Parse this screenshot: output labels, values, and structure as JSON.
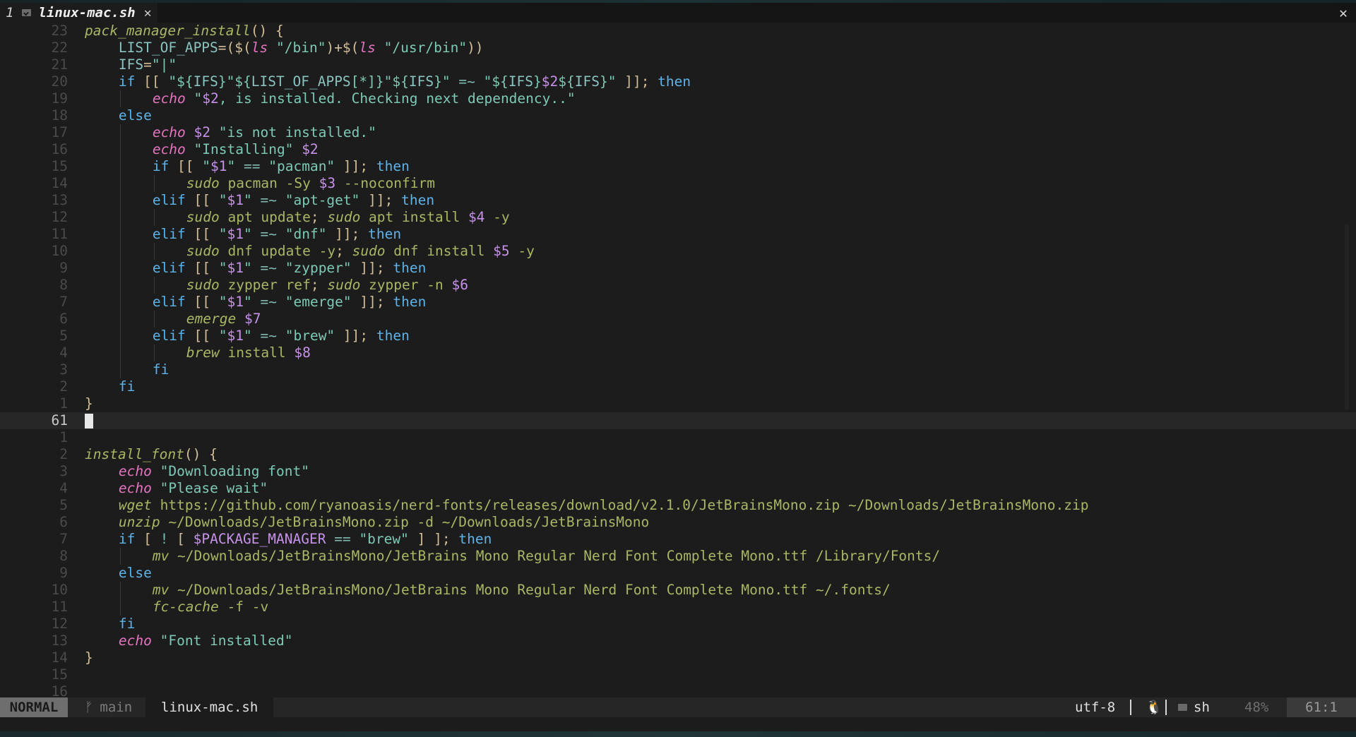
{
  "tabline": {
    "tab_number": "1",
    "file_icon": "file-icon",
    "tab_label": "linux-mac.sh",
    "tab_close": "✕",
    "close_all": "✕"
  },
  "editor": {
    "lines": [
      {
        "n": "23",
        "indent": 0,
        "segs": [
          [
            "fn",
            "pack_manager_install"
          ],
          [
            "pn",
            "() {"
          ]
        ]
      },
      {
        "n": "22",
        "indent": 1,
        "segs": [
          [
            "id",
            "LIST_OF_APPS"
          ],
          [
            "sv",
            "=($("
          ],
          [
            "cmd",
            "ls"
          ],
          [
            "sv",
            " "
          ],
          [
            "str",
            "\"/bin\""
          ],
          [
            "sv",
            ")+$("
          ],
          [
            "cmd",
            "ls"
          ],
          [
            "sv",
            " "
          ],
          [
            "str",
            "\"/usr/bin\""
          ],
          [
            "sv",
            "))"
          ]
        ]
      },
      {
        "n": "21",
        "indent": 1,
        "segs": [
          [
            "id",
            "IFS"
          ],
          [
            "sv",
            "="
          ],
          [
            "str",
            "\"|\""
          ]
        ]
      },
      {
        "n": "20",
        "indent": 1,
        "segs": [
          [
            "kw",
            "if"
          ],
          [
            "sv",
            " [[ "
          ],
          [
            "str",
            "\"${"
          ],
          [
            "id",
            "IFS"
          ],
          [
            "str",
            "}\"${"
          ],
          [
            "id",
            "LIST_OF_APPS"
          ],
          [
            "str",
            "[*]}\"${"
          ],
          [
            "id",
            "IFS"
          ],
          [
            "str",
            "}\""
          ],
          [
            "sv",
            " "
          ],
          [
            "op",
            "=~"
          ],
          [
            "sv",
            " "
          ],
          [
            "str",
            "\"${"
          ],
          [
            "id",
            "IFS"
          ],
          [
            "str",
            "}"
          ],
          [
            "var",
            "$2"
          ],
          [
            "str",
            "${"
          ],
          [
            "id",
            "IFS"
          ],
          [
            "str",
            "}\""
          ],
          [
            "sv",
            " ]]; "
          ],
          [
            "kw",
            "then"
          ]
        ]
      },
      {
        "n": "19",
        "indent": 2,
        "segs": [
          [
            "cmd",
            "echo"
          ],
          [
            "sv",
            " "
          ],
          [
            "str",
            "\""
          ],
          [
            "var",
            "$2"
          ],
          [
            "str",
            ", is installed. Checking next dependency..\""
          ]
        ]
      },
      {
        "n": "18",
        "indent": 1,
        "segs": [
          [
            "kw",
            "else"
          ]
        ]
      },
      {
        "n": "17",
        "indent": 2,
        "segs": [
          [
            "cmd",
            "echo"
          ],
          [
            "sv",
            " "
          ],
          [
            "var",
            "$2"
          ],
          [
            "sv",
            " "
          ],
          [
            "str",
            "\"is not installed.\""
          ]
        ]
      },
      {
        "n": "16",
        "indent": 2,
        "segs": [
          [
            "cmd",
            "echo"
          ],
          [
            "sv",
            " "
          ],
          [
            "str",
            "\"Installing\""
          ],
          [
            "sv",
            " "
          ],
          [
            "var",
            "$2"
          ]
        ]
      },
      {
        "n": "15",
        "indent": 2,
        "segs": [
          [
            "kw",
            "if"
          ],
          [
            "sv",
            " [[ "
          ],
          [
            "str",
            "\""
          ],
          [
            "var",
            "$1"
          ],
          [
            "str",
            "\""
          ],
          [
            "sv",
            " "
          ],
          [
            "op",
            "=="
          ],
          [
            "sv",
            " "
          ],
          [
            "str",
            "\"pacman\""
          ],
          [
            "sv",
            " ]]; "
          ],
          [
            "kw",
            "then"
          ]
        ]
      },
      {
        "n": "14",
        "indent": 3,
        "segs": [
          [
            "ucmd",
            "sudo"
          ],
          [
            "arg",
            " pacman -Sy "
          ],
          [
            "var",
            "$3"
          ],
          [
            "arg",
            " --noconfirm"
          ]
        ]
      },
      {
        "n": "13",
        "indent": 2,
        "segs": [
          [
            "kw",
            "elif"
          ],
          [
            "sv",
            " [[ "
          ],
          [
            "str",
            "\""
          ],
          [
            "var",
            "$1"
          ],
          [
            "str",
            "\""
          ],
          [
            "sv",
            " "
          ],
          [
            "op",
            "=~"
          ],
          [
            "sv",
            " "
          ],
          [
            "str",
            "\"apt-get\""
          ],
          [
            "sv",
            " ]]; "
          ],
          [
            "kw",
            "then"
          ]
        ]
      },
      {
        "n": "12",
        "indent": 3,
        "segs": [
          [
            "ucmd",
            "sudo"
          ],
          [
            "arg",
            " apt update"
          ],
          [
            "sv",
            "; "
          ],
          [
            "ucmd",
            "sudo"
          ],
          [
            "arg",
            " apt install "
          ],
          [
            "var",
            "$4"
          ],
          [
            "arg",
            " -y"
          ]
        ]
      },
      {
        "n": "11",
        "indent": 2,
        "segs": [
          [
            "kw",
            "elif"
          ],
          [
            "sv",
            " [[ "
          ],
          [
            "str",
            "\""
          ],
          [
            "var",
            "$1"
          ],
          [
            "str",
            "\""
          ],
          [
            "sv",
            " "
          ],
          [
            "op",
            "=~"
          ],
          [
            "sv",
            " "
          ],
          [
            "str",
            "\"dnf\""
          ],
          [
            "sv",
            " ]]; "
          ],
          [
            "kw",
            "then"
          ]
        ]
      },
      {
        "n": "10",
        "indent": 3,
        "segs": [
          [
            "ucmd",
            "sudo"
          ],
          [
            "arg",
            " dnf update -y"
          ],
          [
            "sv",
            "; "
          ],
          [
            "ucmd",
            "sudo"
          ],
          [
            "arg",
            " dnf install "
          ],
          [
            "var",
            "$5"
          ],
          [
            "arg",
            " -y"
          ]
        ]
      },
      {
        "n": "9",
        "indent": 2,
        "segs": [
          [
            "kw",
            "elif"
          ],
          [
            "sv",
            " [[ "
          ],
          [
            "str",
            "\""
          ],
          [
            "var",
            "$1"
          ],
          [
            "str",
            "\""
          ],
          [
            "sv",
            " "
          ],
          [
            "op",
            "=~"
          ],
          [
            "sv",
            " "
          ],
          [
            "str",
            "\"zypper\""
          ],
          [
            "sv",
            " ]]; "
          ],
          [
            "kw",
            "then"
          ]
        ]
      },
      {
        "n": "8",
        "indent": 3,
        "segs": [
          [
            "ucmd",
            "sudo"
          ],
          [
            "arg",
            " zypper ref"
          ],
          [
            "sv",
            "; "
          ],
          [
            "ucmd",
            "sudo"
          ],
          [
            "arg",
            " zypper -n "
          ],
          [
            "var",
            "$6"
          ]
        ]
      },
      {
        "n": "7",
        "indent": 2,
        "segs": [
          [
            "kw",
            "elif"
          ],
          [
            "sv",
            " [[ "
          ],
          [
            "str",
            "\""
          ],
          [
            "var",
            "$1"
          ],
          [
            "str",
            "\""
          ],
          [
            "sv",
            " "
          ],
          [
            "op",
            "=~"
          ],
          [
            "sv",
            " "
          ],
          [
            "str",
            "\"emerge\""
          ],
          [
            "sv",
            " ]]; "
          ],
          [
            "kw",
            "then"
          ]
        ]
      },
      {
        "n": "6",
        "indent": 3,
        "segs": [
          [
            "ucmd",
            "emerge"
          ],
          [
            "sv",
            " "
          ],
          [
            "var",
            "$7"
          ]
        ]
      },
      {
        "n": "5",
        "indent": 2,
        "segs": [
          [
            "kw",
            "elif"
          ],
          [
            "sv",
            " [[ "
          ],
          [
            "str",
            "\""
          ],
          [
            "var",
            "$1"
          ],
          [
            "str",
            "\""
          ],
          [
            "sv",
            " "
          ],
          [
            "op",
            "=~"
          ],
          [
            "sv",
            " "
          ],
          [
            "str",
            "\"brew\""
          ],
          [
            "sv",
            " ]]; "
          ],
          [
            "kw",
            "then"
          ]
        ]
      },
      {
        "n": "4",
        "indent": 3,
        "segs": [
          [
            "ucmd",
            "brew"
          ],
          [
            "arg",
            " install "
          ],
          [
            "var",
            "$8"
          ]
        ]
      },
      {
        "n": "3",
        "indent": 2,
        "segs": [
          [
            "kw",
            "fi"
          ]
        ]
      },
      {
        "n": "2",
        "indent": 1,
        "segs": [
          [
            "kw",
            "fi"
          ]
        ]
      },
      {
        "n": "1",
        "indent": 0,
        "segs": [
          [
            "pn",
            "}"
          ]
        ]
      },
      {
        "n": "61",
        "indent": 0,
        "current": true,
        "segs": []
      },
      {
        "n": "1",
        "indent": 0,
        "segs": []
      },
      {
        "n": "2",
        "indent": 0,
        "segs": [
          [
            "fn",
            "install_font"
          ],
          [
            "pn",
            "() {"
          ]
        ]
      },
      {
        "n": "3",
        "indent": 1,
        "segs": [
          [
            "cmd",
            "echo"
          ],
          [
            "sv",
            " "
          ],
          [
            "str",
            "\"Downloading font\""
          ]
        ]
      },
      {
        "n": "4",
        "indent": 1,
        "segs": [
          [
            "cmd",
            "echo"
          ],
          [
            "sv",
            " "
          ],
          [
            "str",
            "\"Please wait\""
          ]
        ]
      },
      {
        "n": "5",
        "indent": 1,
        "segs": [
          [
            "ucmd",
            "wget"
          ],
          [
            "arg",
            " https://github.com/ryanoasis/nerd-fonts/releases/download/v2.1.0/JetBrainsMono.zip ~/Downloads/JetBrainsMono.zip"
          ]
        ]
      },
      {
        "n": "6",
        "indent": 1,
        "segs": [
          [
            "ucmd",
            "unzip"
          ],
          [
            "arg",
            " ~/Downloads/JetBrainsMono.zip -d ~/Downloads/JetBrainsMono"
          ]
        ]
      },
      {
        "n": "7",
        "indent": 1,
        "segs": [
          [
            "kw",
            "if"
          ],
          [
            "sv",
            " [ "
          ],
          [
            "op",
            "!"
          ],
          [
            "sv",
            " [ "
          ],
          [
            "var",
            "$PACKAGE_MANAGER"
          ],
          [
            "sv",
            " "
          ],
          [
            "op",
            "=="
          ],
          [
            "sv",
            " "
          ],
          [
            "str",
            "\"brew\""
          ],
          [
            "sv",
            " ] ]; "
          ],
          [
            "kw",
            "then"
          ]
        ]
      },
      {
        "n": "8",
        "indent": 2,
        "segs": [
          [
            "ucmd",
            "mv"
          ],
          [
            "arg",
            " ~/Downloads/JetBrainsMono/JetBrains Mono Regular Nerd Font Complete Mono.ttf /Library/Fonts/"
          ]
        ]
      },
      {
        "n": "9",
        "indent": 1,
        "segs": [
          [
            "kw",
            "else"
          ]
        ]
      },
      {
        "n": "10",
        "indent": 2,
        "segs": [
          [
            "ucmd",
            "mv"
          ],
          [
            "arg",
            " ~/Downloads/JetBrainsMono/JetBrains Mono Regular Nerd Font Complete Mono.ttf ~/.fonts/"
          ]
        ]
      },
      {
        "n": "11",
        "indent": 2,
        "segs": [
          [
            "ucmd",
            "fc-cache"
          ],
          [
            "arg",
            " -f -v"
          ]
        ]
      },
      {
        "n": "12",
        "indent": 1,
        "segs": [
          [
            "kw",
            "fi"
          ]
        ]
      },
      {
        "n": "13",
        "indent": 1,
        "segs": [
          [
            "cmd",
            "echo"
          ],
          [
            "sv",
            " "
          ],
          [
            "str",
            "\"Font installed\""
          ]
        ]
      },
      {
        "n": "14",
        "indent": 0,
        "segs": [
          [
            "pn",
            "}"
          ]
        ]
      },
      {
        "n": "15",
        "indent": 0,
        "segs": []
      },
      {
        "n": "16",
        "indent": 0,
        "segs": []
      }
    ]
  },
  "statusline": {
    "mode": "NORMAL",
    "branch_icon": "git-branch-icon",
    "branch": "main",
    "filename": "linux-mac.sh",
    "encoding": "utf-8",
    "os_icon": "linux-tux-icon",
    "os_glyph": "🐧",
    "filetype_icon": "file-icon",
    "filetype": "sh",
    "percent": "48%",
    "position": "61:1"
  },
  "colors": {
    "background": "#1c1c1c",
    "keyword": "#5eb2e8",
    "builtin_command": "#e373c0",
    "string": "#7ec9b5",
    "variable": "#c792ea",
    "function": "#a9b665",
    "mode_badge": "#6e6e6e"
  }
}
